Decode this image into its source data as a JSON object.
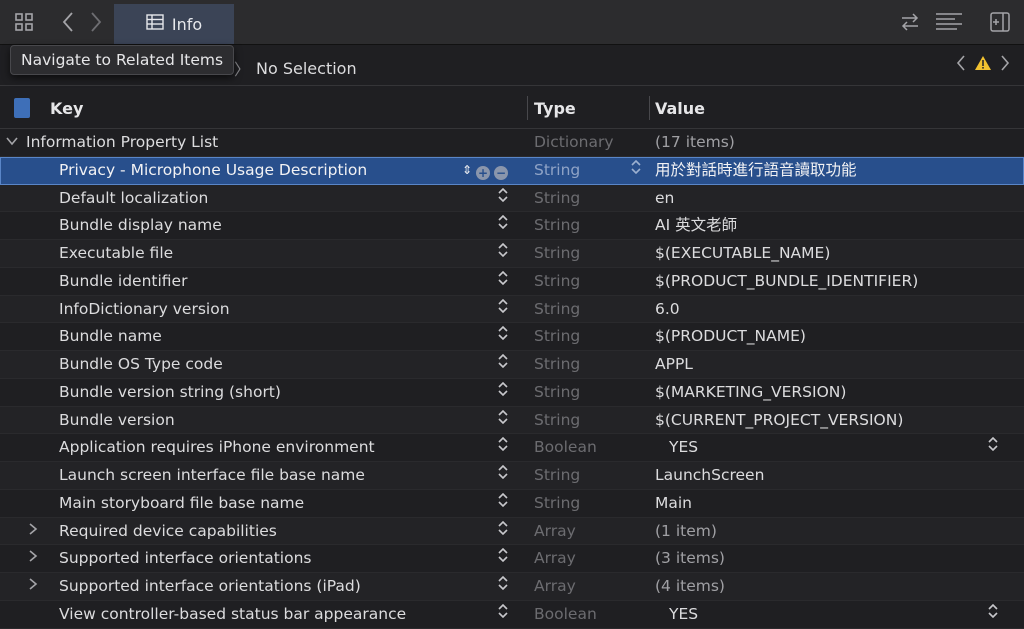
{
  "toolbar": {
    "tab_label": "Info",
    "icons": [
      "grid-icon",
      "back-icon",
      "forward-icon",
      "table-icon",
      "swap-icon",
      "lines-icon",
      "inspector-icon"
    ]
  },
  "tooltip": "Navigate to Related Items",
  "jumpbar": {
    "selection": "No Selection"
  },
  "columns": {
    "key": "Key",
    "type": "Type",
    "value": "Value"
  },
  "root": {
    "key": "Information Property List",
    "type": "Dictionary",
    "value": "(17 items)"
  },
  "rows": [
    {
      "key": "Privacy - Microphone Usage Description",
      "type": "String",
      "value": "用於對話時進行語音讀取功能",
      "selected": true
    },
    {
      "key": "Default localization",
      "type": "String",
      "value": "en"
    },
    {
      "key": "Bundle display name",
      "type": "String",
      "value": "AI 英文老師"
    },
    {
      "key": "Executable file",
      "type": "String",
      "value": "$(EXECUTABLE_NAME)"
    },
    {
      "key": "Bundle identifier",
      "type": "String",
      "value": "$(PRODUCT_BUNDLE_IDENTIFIER)"
    },
    {
      "key": "InfoDictionary version",
      "type": "String",
      "value": "6.0"
    },
    {
      "key": "Bundle name",
      "type": "String",
      "value": "$(PRODUCT_NAME)"
    },
    {
      "key": "Bundle OS Type code",
      "type": "String",
      "value": "APPL"
    },
    {
      "key": "Bundle version string (short)",
      "type": "String",
      "value": "$(MARKETING_VERSION)"
    },
    {
      "key": "Bundle version",
      "type": "String",
      "value": "$(CURRENT_PROJECT_VERSION)"
    },
    {
      "key": "Application requires iPhone environment",
      "type": "Boolean",
      "value": "YES",
      "popup": true
    },
    {
      "key": "Launch screen interface file base name",
      "type": "String",
      "value": "LaunchScreen"
    },
    {
      "key": "Main storyboard file base name",
      "type": "String",
      "value": "Main"
    },
    {
      "key": "Required device capabilities",
      "type": "Array",
      "value": "(1 item)",
      "expandable": true
    },
    {
      "key": "Supported interface orientations",
      "type": "Array",
      "value": "(3 items)",
      "expandable": true
    },
    {
      "key": "Supported interface orientations (iPad)",
      "type": "Array",
      "value": "(4 items)",
      "expandable": true
    },
    {
      "key": "View controller-based status bar appearance",
      "type": "Boolean",
      "value": "YES",
      "popup": true
    }
  ]
}
